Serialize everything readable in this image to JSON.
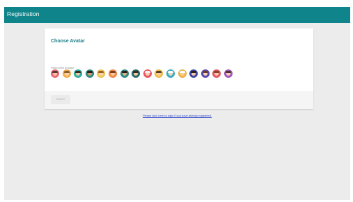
{
  "header": {
    "title": "Registration"
  },
  "card": {
    "title": "Choose Avatar",
    "hint": "Please select an avatar",
    "submit_label": "SUBMIT"
  },
  "avatars": [
    {
      "bg": "#f06b7e",
      "face": "#f6c7a1",
      "hair": "#5a3a2a"
    },
    {
      "bg": "#f9b24e",
      "face": "#f8d1ad",
      "hair": "#8c5a33"
    },
    {
      "bg": "#27b3a3",
      "face": "#f3c8a3",
      "hair": "#3b2a20"
    },
    {
      "bg": "#2f8e85",
      "face": "#d79a6c",
      "hair": "#2a1c13"
    },
    {
      "bg": "#f5cc55",
      "face": "#f7d3b0",
      "hair": "#9b5f2c"
    },
    {
      "bg": "#f68c45",
      "face": "#f7c9a0",
      "hair": "#7a3b1f"
    },
    {
      "bg": "#2d8f89",
      "face": "#e1ad82",
      "hair": "#2b1d16"
    },
    {
      "bg": "#246f6b",
      "face": "#f3caa4",
      "hair": "#3c2a21"
    },
    {
      "bg": "#f05a67",
      "face": "#f7d2b3",
      "hair": "#f3f3f3"
    },
    {
      "bg": "#f7c149",
      "face": "#f6d0ad",
      "hair": "#5b3927"
    },
    {
      "bg": "#3ab0c7",
      "face": "#f5d5b6",
      "hair": "#ffffff"
    },
    {
      "bg": "#f6b84a",
      "face": "#f7cf9c",
      "hair": "#ffffff"
    },
    {
      "bg": "#3c4aa7",
      "face": "#f4cba6",
      "hair": "#2c1f18"
    },
    {
      "bg": "#5a4bb3",
      "face": "#f7d4b5",
      "hair": "#6c3d24"
    },
    {
      "bg": "#ef5567",
      "face": "#f6d0ad",
      "hair": "#834422"
    },
    {
      "bg": "#a45ac3",
      "face": "#f7d3b2",
      "hair": "#4d3126"
    }
  ],
  "footer": {
    "login_link": "Please click here to login if you have already registered."
  }
}
